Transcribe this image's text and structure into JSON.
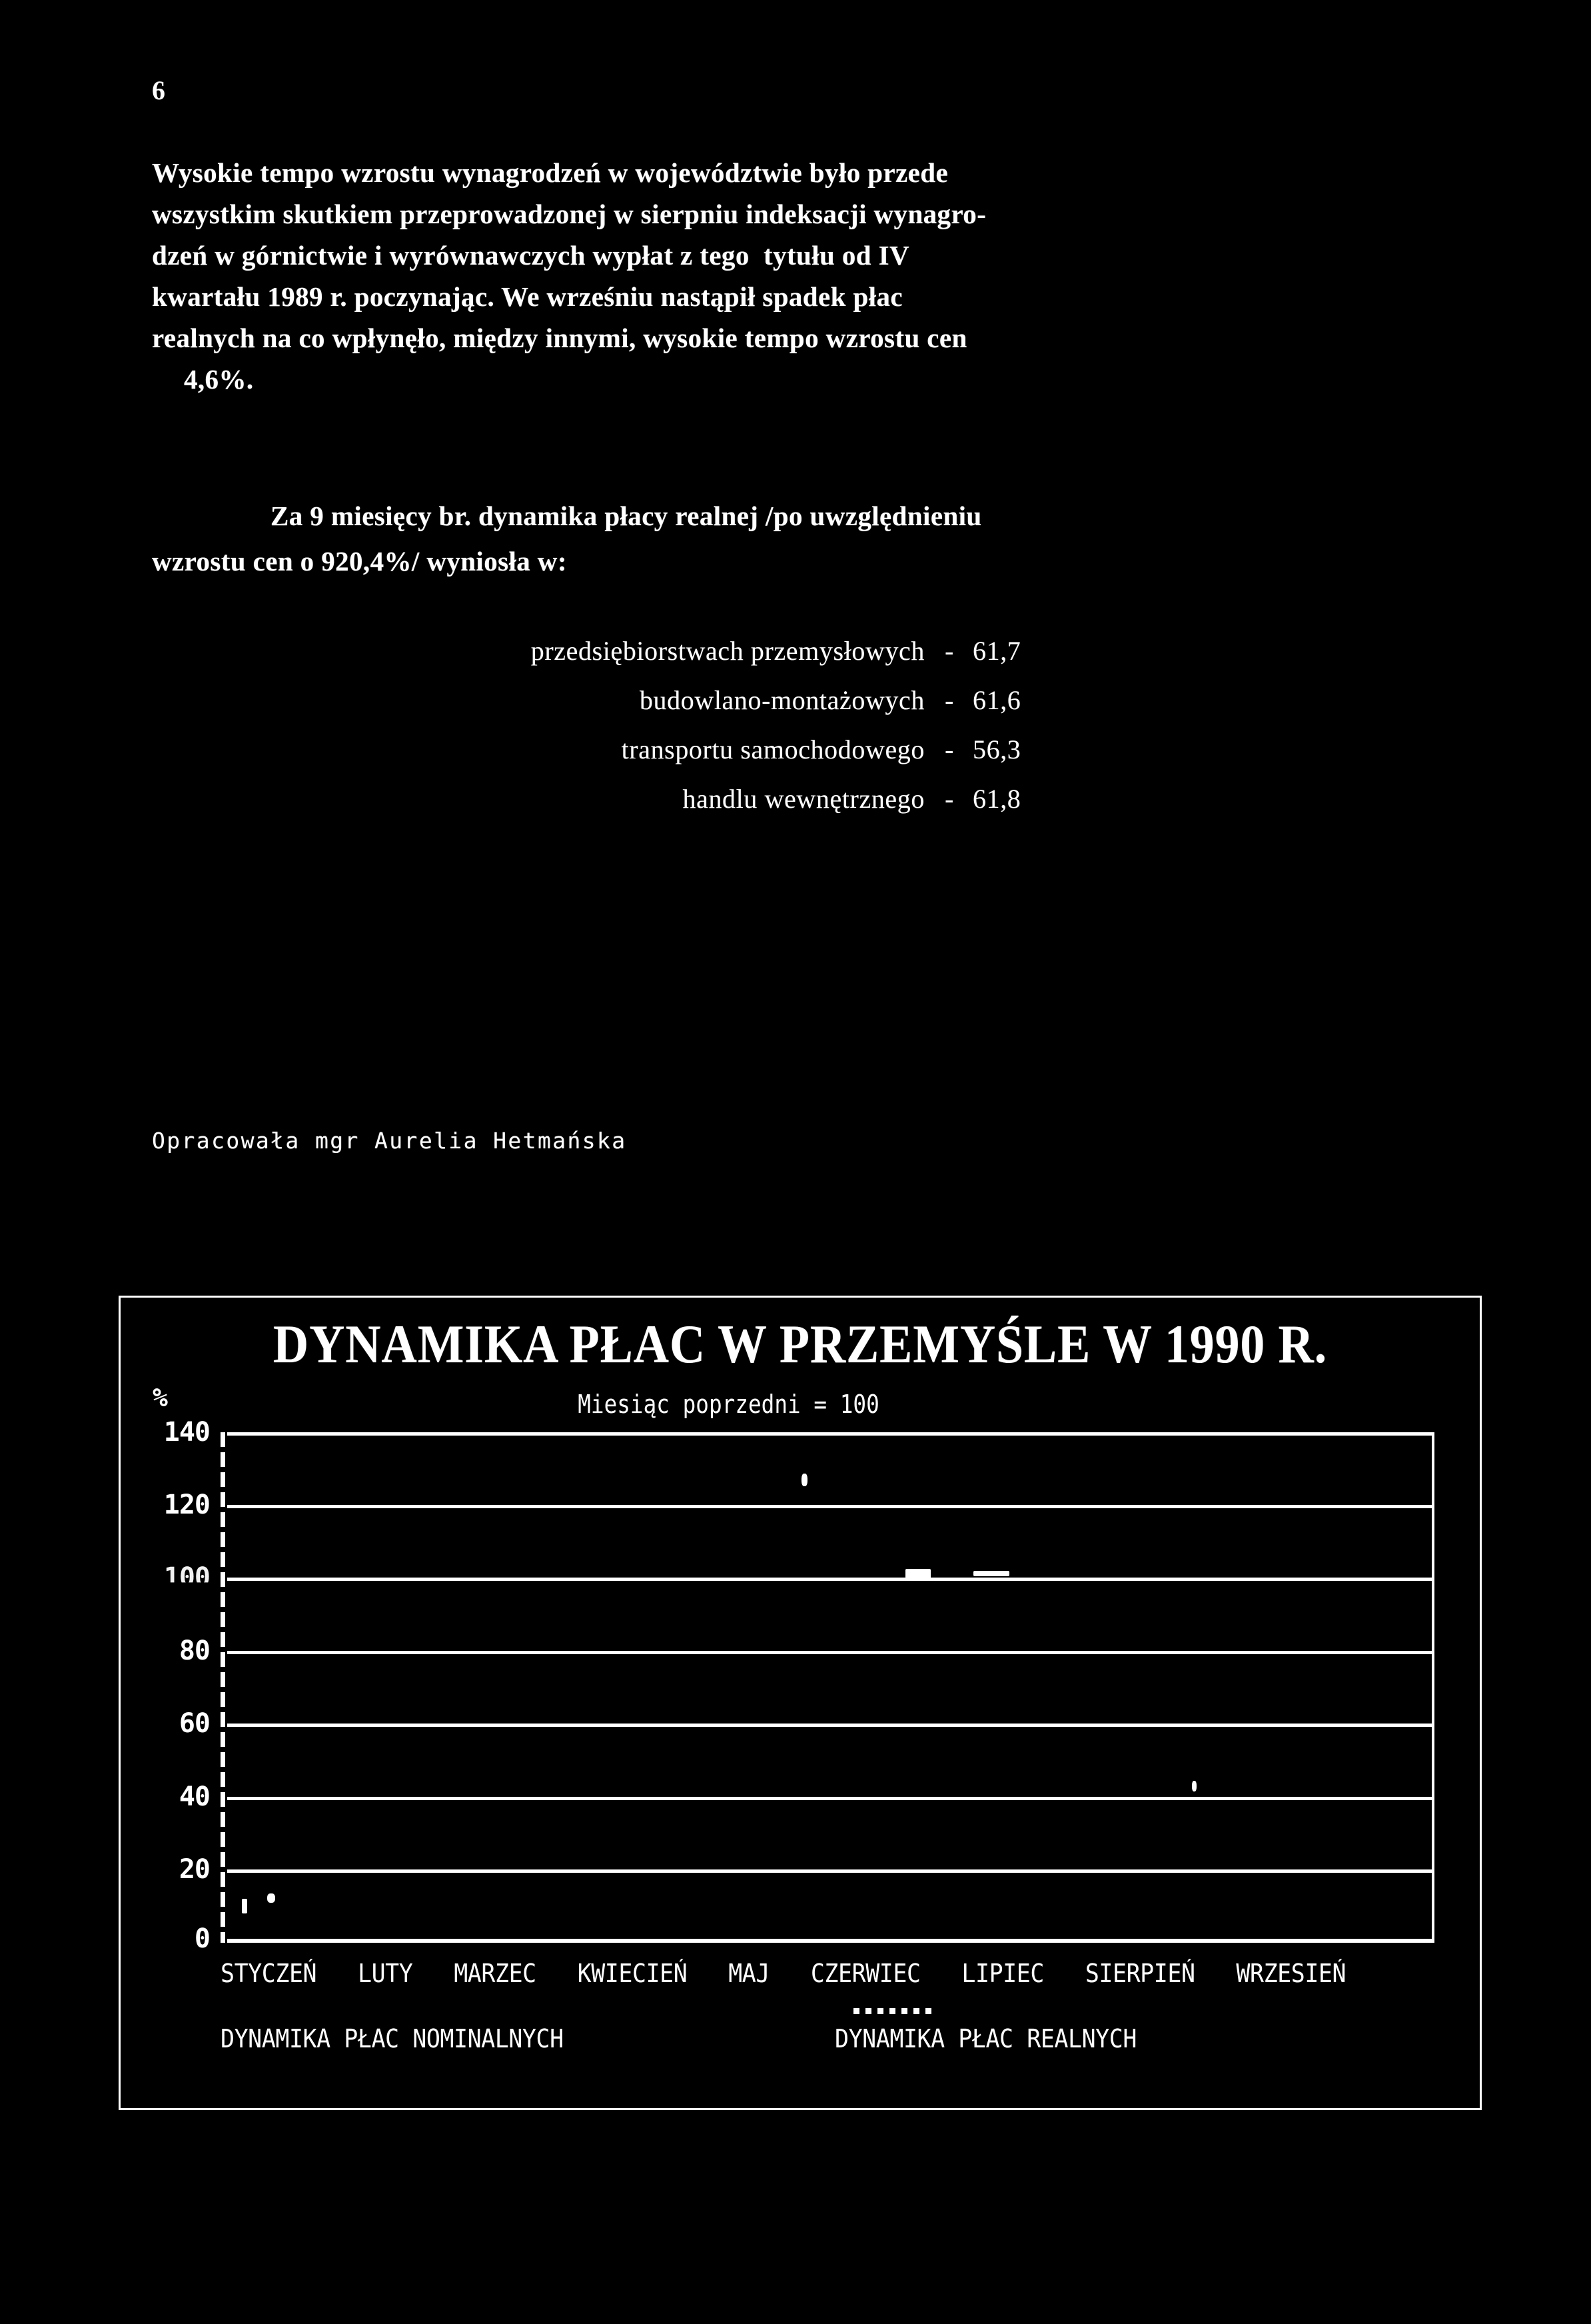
{
  "page": {
    "number": "6"
  },
  "paragraph1": {
    "lines": [
      "Wysokie tempo wzrostu wynagrodzeń w województwie było przede",
      "wszystkim skutkiem przeprowadzonej w sierpniu indeksacji wynagro-",
      "dzeń w górnictwie i wyrównawczych wypłat z tego  tytułu od IV",
      "kwartału 1989 r. poczynając. We wrześniu nastąpił spadek płac",
      "realnych na co wpłynęło, między innymi, wysokie tempo wzrostu cen",
      "4,6%."
    ]
  },
  "paragraph2": {
    "line1": "Za 9 miesięcy br. dynamika płacy realnej /po uwzględnieniu",
    "line2": "wzrostu cen o 920,4%/ wyniosła w:"
  },
  "branches": {
    "rows": [
      {
        "label": "przedsiębiorstwach przemysłowych",
        "dash": "-",
        "value": "61,7"
      },
      {
        "label": "budowlano-montażowych",
        "dash": "-",
        "value": "61,6"
      },
      {
        "label": "transportu samochodowego",
        "dash": "-",
        "value": "56,3"
      },
      {
        "label": "handlu wewnętrznego",
        "dash": "-",
        "value": "61,8"
      }
    ]
  },
  "credit": {
    "text": "Opracowała mgr Aurelia Hetmańska"
  },
  "chart_data": {
    "type": "line",
    "title": "DYNAMIKA PŁAC W PRZEMYŚLE W 1990 R.",
    "subtitle": "Miesiąc poprzedni = 100",
    "unit_label": "%",
    "xlabel": "",
    "ylabel": "%",
    "grid": true,
    "legend_position": "bottom",
    "ylim": [
      0,
      140
    ],
    "yticks": [
      140,
      120,
      100,
      80,
      60,
      40,
      20,
      0
    ],
    "ytick_labels": [
      "140",
      "120",
      "100",
      "80",
      "60",
      "40",
      "20",
      "0"
    ],
    "categories": [
      "STYCZEŃ",
      "LUTY",
      "MARZEC",
      "KWIECIEŃ",
      "MAJ",
      "CZERWIEC",
      "LIPIEC",
      "SIERPIEŃ",
      "WRZESIEŃ"
    ],
    "series": [
      {
        "name": "DYNAMIKA PŁAC NOMINALNYCH",
        "style": "solid",
        "values": [
          null,
          null,
          null,
          null,
          null,
          null,
          null,
          null,
          null
        ]
      },
      {
        "name": "DYNAMIKA PŁAC REALNYCH",
        "style": "dashed",
        "values": [
          null,
          null,
          null,
          null,
          null,
          null,
          null,
          null,
          null
        ]
      }
    ],
    "note": "Plotted series lines are not legible in this scan; only the axes, gridlines, labels and legend survive."
  },
  "colors": {
    "background": "#000000",
    "ink": "#ffffff"
  }
}
